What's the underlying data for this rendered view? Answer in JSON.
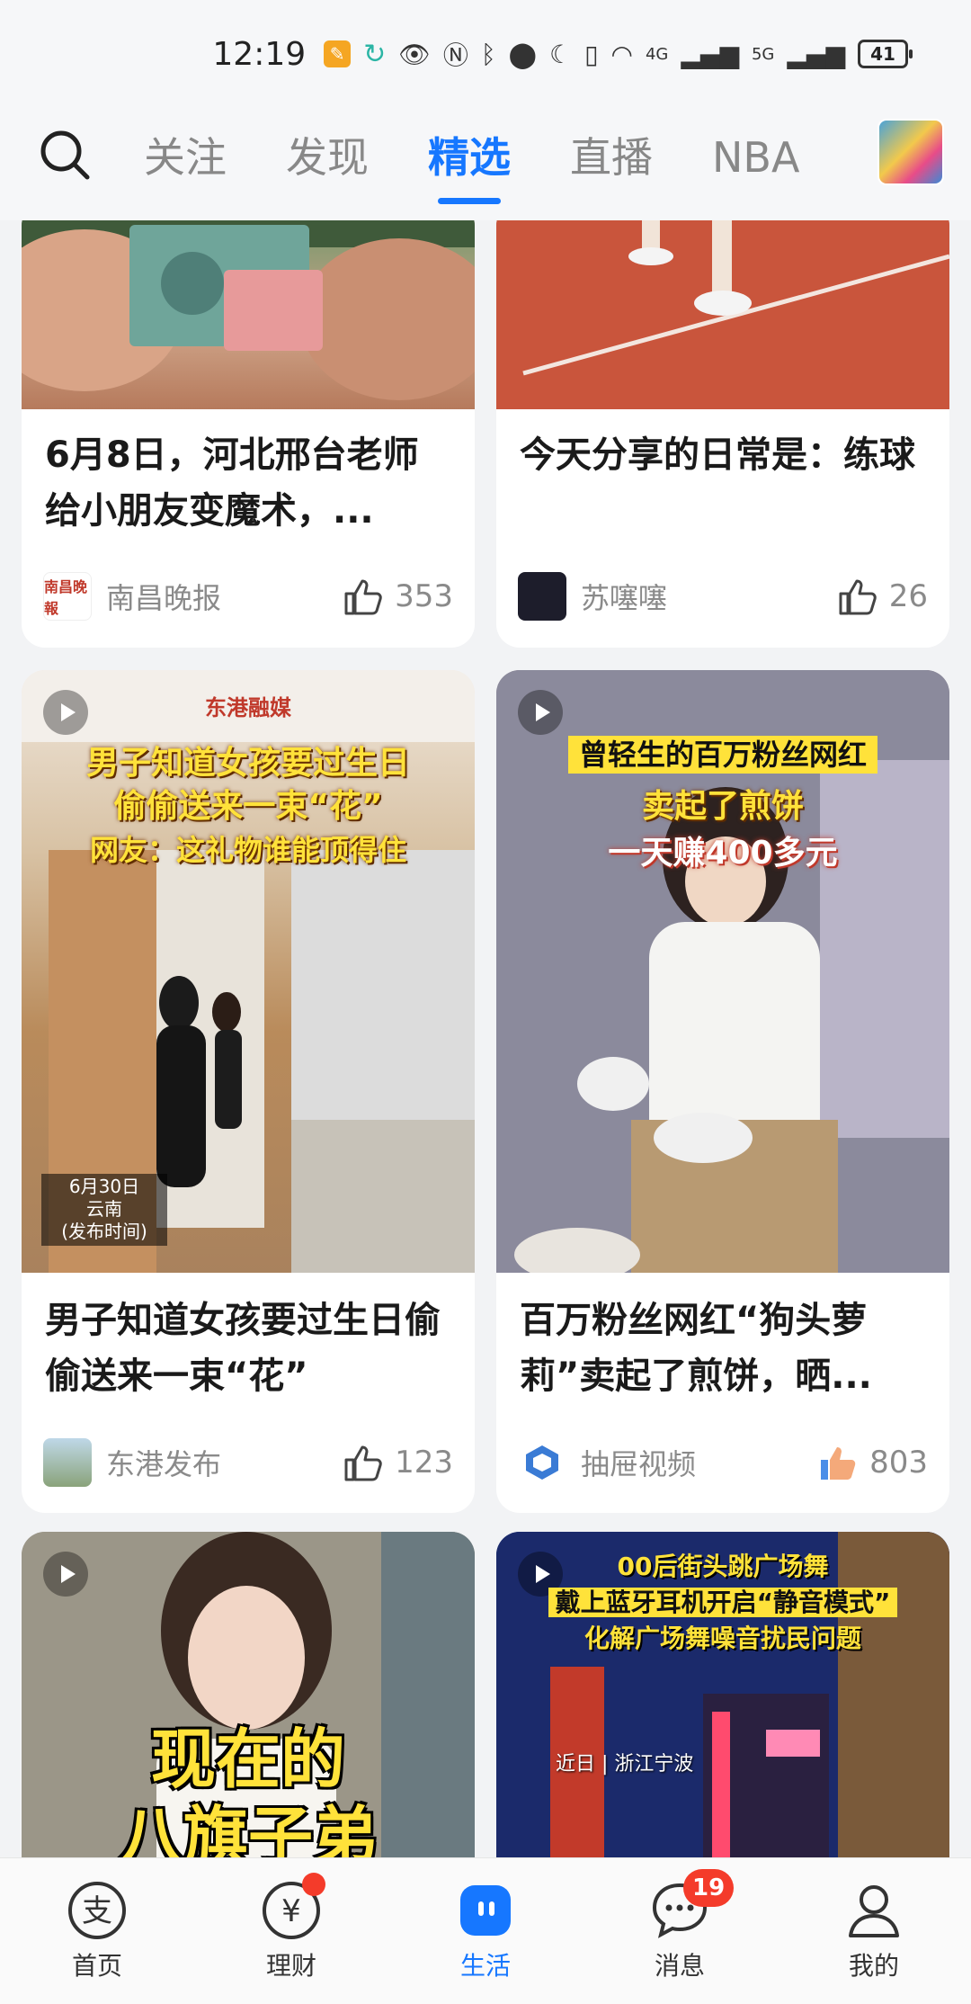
{
  "status_bar": {
    "time": "12:19",
    "signal_4g": "4G",
    "signal_5g": "5G",
    "battery": "41"
  },
  "top_nav": {
    "tabs": [
      {
        "label": "关注",
        "active": false
      },
      {
        "label": "发现",
        "active": false
      },
      {
        "label": "精选",
        "active": true
      },
      {
        "label": "直播",
        "active": false
      },
      {
        "label": "NBA",
        "active": false
      }
    ]
  },
  "feed": {
    "cards": [
      {
        "title": "6月8日，河北邢台老师给小朋友变魔术，...",
        "source": "南昌晚报",
        "likes": "353",
        "source_avatar_text": "南昌晚報"
      },
      {
        "title": "今天分享的日常是：练球",
        "source": "苏噻噻",
        "likes": "26"
      },
      {
        "title": "男子知道女孩要过生日偷偷送来一束“花”",
        "source": "东港发布",
        "likes": "123",
        "brand": "东港融媒",
        "overlay_lines": [
          "男子知道女孩要过生日",
          "偷偷送来一束“花”",
          "网友：这礼物谁能顶得住"
        ],
        "caption_lines": [
          "6月30日",
          "云南",
          "(发布时间)"
        ]
      },
      {
        "title": "百万粉丝网红“狗头萝莉”卖起了煎饼，晒...",
        "source": "抽屉视频",
        "likes": "803",
        "overlay_lines": [
          "曾轻生的百万粉丝网红",
          "卖起了煎饼",
          "一天赚400多元"
        ]
      },
      {
        "overlay_lines": [
          "现在的",
          "八旗子弟"
        ]
      },
      {
        "overlay_lines": [
          "00后街头跳广场舞",
          "戴上蓝牙耳机开启“静音模式”",
          "化解广场舞噪音扰民问题"
        ],
        "caption": "近日 | 浙江宁波"
      }
    ]
  },
  "bottom_nav": {
    "items": [
      {
        "label": "首页",
        "active": false
      },
      {
        "label": "理财",
        "active": false
      },
      {
        "label": "生活",
        "active": true
      },
      {
        "label": "消息",
        "active": false,
        "badge": "19"
      },
      {
        "label": "我的",
        "active": false
      }
    ]
  },
  "colors": {
    "accent": "#1677ff",
    "badge_red": "#f43b2a"
  }
}
